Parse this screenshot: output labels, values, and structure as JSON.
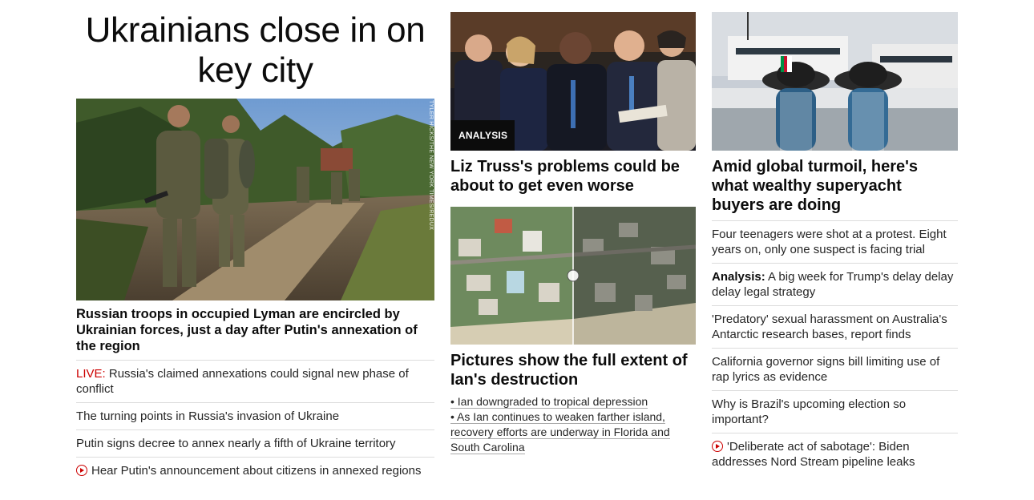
{
  "col1": {
    "hero_title": "Ukrainians close in on key city",
    "photo_credit": "TYLER HICKS/THE NEW YORK TIMES/REDUX",
    "main_headline": "Russian troops in occupied Lyman are encircled by Ukrainian forces, just a day after Putin's annexation of the region",
    "links": [
      {
        "prefix": "LIVE:",
        "text": "Russia's claimed annexations could signal new phase of conflict"
      },
      {
        "prefix": "",
        "text": "The turning points in Russia's invasion of Ukraine"
      },
      {
        "prefix": "",
        "text": "Putin signs decree to annex nearly a fifth of Ukraine territory"
      },
      {
        "prefix": "",
        "text": "Hear Putin's announcement about citizens in annexed regions",
        "video": true
      }
    ]
  },
  "col2": {
    "card1": {
      "badge": "ANALYSIS",
      "headline": "Liz Truss's problems could be about to get even worse"
    },
    "card2": {
      "headline": "Pictures show the full extent of Ian's destruction",
      "bullets": [
        "• Ian downgraded to tropical depression",
        "• As Ian continues to weaken farther island, recovery efforts are underway in Florida and South Carolina"
      ]
    }
  },
  "col3": {
    "headline": "Amid global turmoil, here's what wealthy superyacht buyers are doing",
    "links": [
      {
        "prefix": "",
        "text": "Four teenagers were shot at a protest. Eight years on, only one suspect is facing trial"
      },
      {
        "prefix": "Analysis:",
        "text": " A big week for Trump's delay delay delay legal strategy"
      },
      {
        "prefix": "",
        "text": "'Predatory' sexual harassment on Australia's Antarctic research bases, report finds"
      },
      {
        "prefix": "",
        "text": "California governor signs bill limiting use of rap lyrics as evidence"
      },
      {
        "prefix": "",
        "text": "Why is Brazil's upcoming election so important?"
      },
      {
        "prefix": "",
        "text": "'Deliberate act of sabotage': Biden addresses Nord Stream pipeline leaks",
        "video": true
      }
    ]
  },
  "colors": {
    "live": "#cc0000",
    "text": "#0c0c0c",
    "divider": "#dcdcdc"
  }
}
